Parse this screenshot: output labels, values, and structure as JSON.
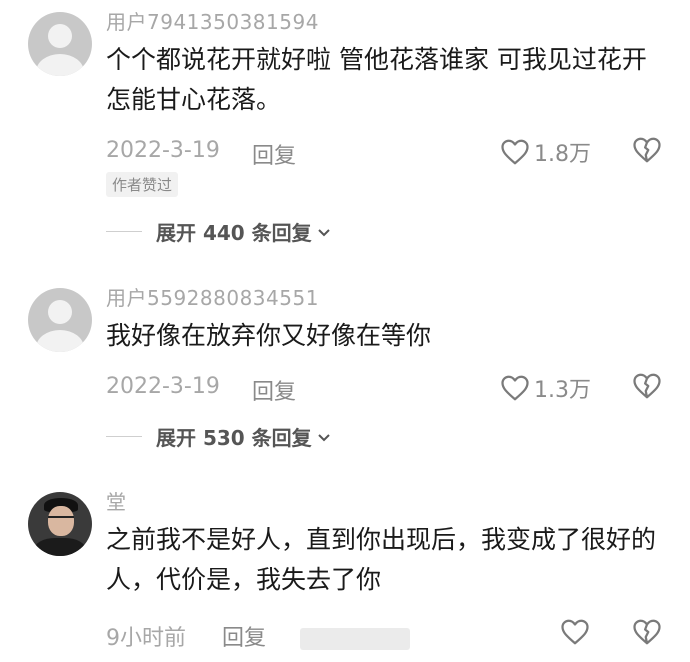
{
  "comments": [
    {
      "username": "用户7941350381594",
      "text": "个个都说花开就好啦 管他花落谁家 可我见过花开 怎能甘心花落。",
      "date": "2022-3-19",
      "reply_label": "回复",
      "likes": "1.8万",
      "author_badge": "作者赞过",
      "expand_label": "展开 440 条回复"
    },
    {
      "username": "用户5592880834551",
      "text": "我好像在放弃你又好像在等你",
      "date": "2022-3-19",
      "reply_label": "回复",
      "likes": "1.3万",
      "expand_label": "展开 530 条回复"
    },
    {
      "username": "堂",
      "text": "之前我不是好人，直到你出现后，我变成了很好的人，代价是，我失去了你",
      "date": "9小时前",
      "reply_label": "回复",
      "likes": ""
    }
  ],
  "icons": {
    "like": "heart-outline-icon",
    "dislike": "broken-heart-icon",
    "expand": "chevron-down-icon",
    "avatar_default": "default-avatar-icon"
  },
  "colors": {
    "text": "#1a1a1a",
    "muted": "#a7a7a7",
    "background": "#ffffff"
  }
}
